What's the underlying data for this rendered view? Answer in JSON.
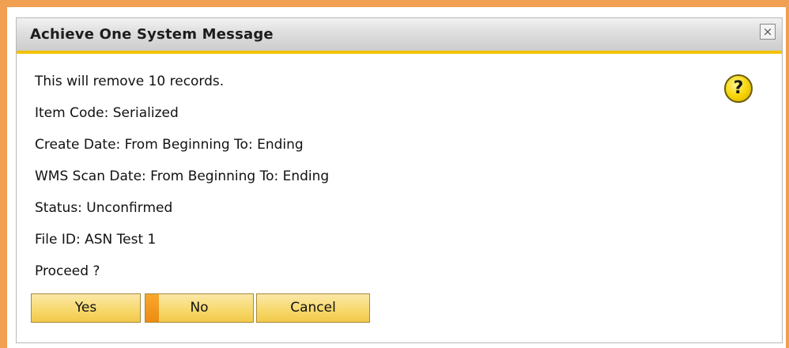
{
  "dialog": {
    "title": "Achieve One System Message",
    "close_label": "×",
    "help_glyph": "?",
    "icons": {
      "close": "close-icon",
      "help": "question-icon"
    },
    "lines": [
      "This will remove 10 records.",
      "Item Code: Serialized",
      "Create Date: From Beginning To: Ending",
      "WMS Scan Date: From Beginning To: Ending",
      "Status: Unconfirmed",
      "File ID: ASN Test 1",
      "Proceed ?"
    ],
    "buttons": {
      "yes": "Yes",
      "no": "No",
      "cancel": "Cancel"
    },
    "focused_button": "No",
    "colors": {
      "frame": "#f0a050",
      "title_accent": "#f2c200",
      "button": "#f7d96e",
      "focus_bar": "#f8a72c"
    }
  }
}
